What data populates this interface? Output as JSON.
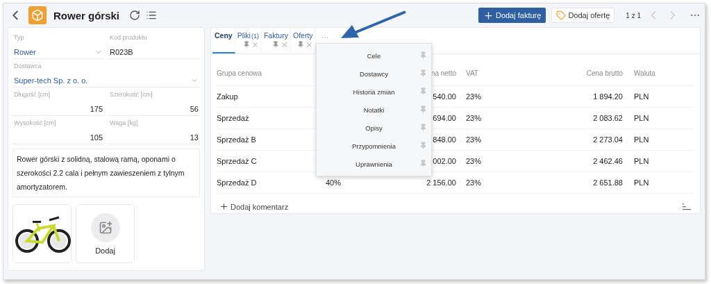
{
  "header": {
    "title": "Rower górski",
    "buttons": [
      {
        "label": "Dodaj fakturę",
        "kind": "primary"
      },
      {
        "label": "Dodaj ofertę",
        "kind": "secondary"
      }
    ],
    "pager": "1 z 1"
  },
  "field_rows": [
    [
      {
        "label": "Typ",
        "value": "Rower",
        "kind": "select"
      },
      {
        "label": "Kod produktu",
        "value": "R023B",
        "kind": "text"
      }
    ],
    [
      {
        "label": "Dostawca",
        "value": "Super-tech Sp. z o. o.",
        "kind": "select"
      }
    ],
    [
      {
        "label": "Długość [cm]",
        "value": "175",
        "kind": "number"
      },
      {
        "label": "Szerokość [cm]",
        "value": "56",
        "kind": "number"
      }
    ],
    [
      {
        "label": "Wysokość [cm]",
        "value": "105",
        "kind": "number"
      },
      {
        "label": "Waga [kg]",
        "value": "13",
        "kind": "number"
      }
    ]
  ],
  "description": "Rower górski z solidną, stalową ramą, oponami o szerokości 2.2 cala i pełnym zawieszeniem z tylnym amortyzatorem.",
  "images": [
    {
      "kind": "picture"
    }
  ],
  "add_image_label": "Dodaj",
  "tabs": [
    {
      "label": "Ceny",
      "selected": true,
      "closable": false
    },
    {
      "label": "Pliki",
      "count": "(1)",
      "selected": false,
      "closable": true
    },
    {
      "label": "Faktury",
      "selected": false,
      "closable": true
    },
    {
      "label": "Oferty",
      "selected": false,
      "closable": true
    }
  ],
  "more_tabs_label": "…",
  "more_menu": [
    "Cele",
    "Dostawcy",
    "Historia zmian",
    "Notatki",
    "Opisy",
    "Przypomnienia",
    "Uprawnienia"
  ],
  "table": {
    "header": {
      "group": "Grupa cenowa",
      "net": "na netto",
      "vat": "VAT",
      "gross": "Cena brutto",
      "currency": "Waluta"
    },
    "rows": [
      {
        "group": "Zakup",
        "net": "540.00",
        "vat": "23%",
        "gross": "1 894.20",
        "currency": "PLN"
      },
      {
        "group": "Sprzedaż",
        "net": "694.00",
        "vat": "23%",
        "gross": "2 083.62",
        "currency": "PLN"
      },
      {
        "group": "Sprzedaż B",
        "net": "848.00",
        "vat": "23%",
        "gross": "2 273.04",
        "currency": "PLN"
      },
      {
        "group": "Sprzedaż C",
        "net": "002.00",
        "vat": "23%",
        "gross": "2 462.46",
        "currency": "PLN"
      },
      {
        "group": "Sprzedaż D",
        "column_2": "40%",
        "net": "2 156.00",
        "vat": "23%",
        "gross": "2 651.88",
        "currency": "PLN"
      }
    ]
  },
  "add_comment": "Dodaj komentarz"
}
